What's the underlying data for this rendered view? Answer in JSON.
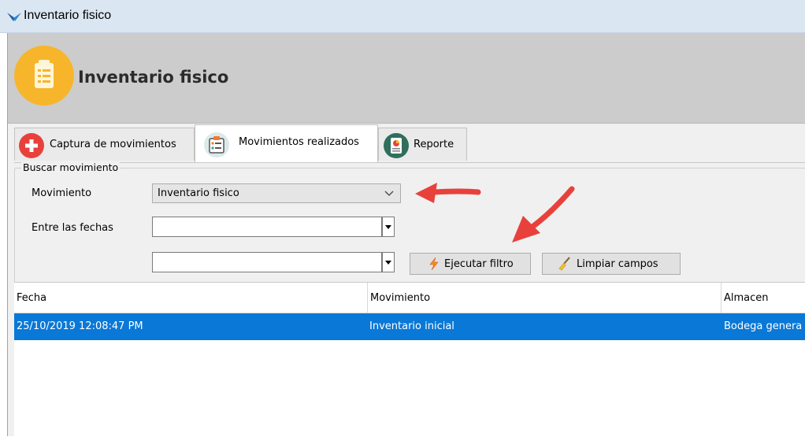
{
  "window": {
    "title": "Inventario fisico"
  },
  "header": {
    "title": "Inventario fisico"
  },
  "tabs": [
    {
      "label": "Captura de movimientos",
      "icon": "plus-circle-icon",
      "active": false
    },
    {
      "label": "Movimientos realizados",
      "icon": "clipboard-list-icon",
      "active": true
    },
    {
      "label": "Reporte",
      "icon": "report-icon",
      "active": false
    }
  ],
  "search": {
    "group_label": "Buscar movimiento",
    "movimiento_label": "Movimiento",
    "movimiento_value": "Inventario fisico",
    "fechas_label": "Entre las fechas",
    "fecha_inicio": "",
    "fecha_fin": "",
    "execute_label": "Ejecutar filtro",
    "clear_label": "Limpiar campos"
  },
  "table": {
    "columns": [
      "Fecha",
      "Movimiento",
      "Almacen"
    ],
    "rows": [
      {
        "fecha": "25/10/2019 12:08:47 PM",
        "movimiento": "Inventario inicial",
        "almacen": "Bodega genera",
        "selected": true
      }
    ]
  },
  "colors": {
    "accent": "#0a78d7",
    "header_icon": "#f7b52c",
    "annotation_arrow": "#e8413c"
  }
}
